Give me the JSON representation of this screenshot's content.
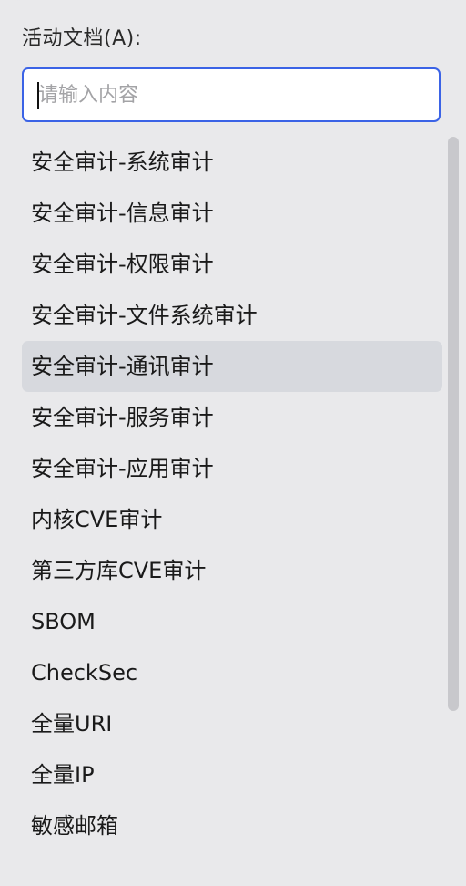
{
  "panel": {
    "label": "活动文档(A):"
  },
  "search": {
    "placeholder": "请输入内容",
    "value": ""
  },
  "list": {
    "selected_index": 4,
    "items": [
      {
        "label": "安全审计-系统审计"
      },
      {
        "label": "安全审计-信息审计"
      },
      {
        "label": "安全审计-权限审计"
      },
      {
        "label": "安全审计-文件系统审计"
      },
      {
        "label": "安全审计-通讯审计"
      },
      {
        "label": "安全审计-服务审计"
      },
      {
        "label": "安全审计-应用审计"
      },
      {
        "label": "内核CVE审计"
      },
      {
        "label": "第三方库CVE审计"
      },
      {
        "label": "SBOM"
      },
      {
        "label": "CheckSec"
      },
      {
        "label": "全量URI"
      },
      {
        "label": "全量IP"
      },
      {
        "label": "敏感邮箱"
      }
    ]
  },
  "colors": {
    "background": "#e9e9eb",
    "accent": "#3b63e6",
    "selected_row": "#d7d9de",
    "scrollbar": "#c8c8cc"
  }
}
